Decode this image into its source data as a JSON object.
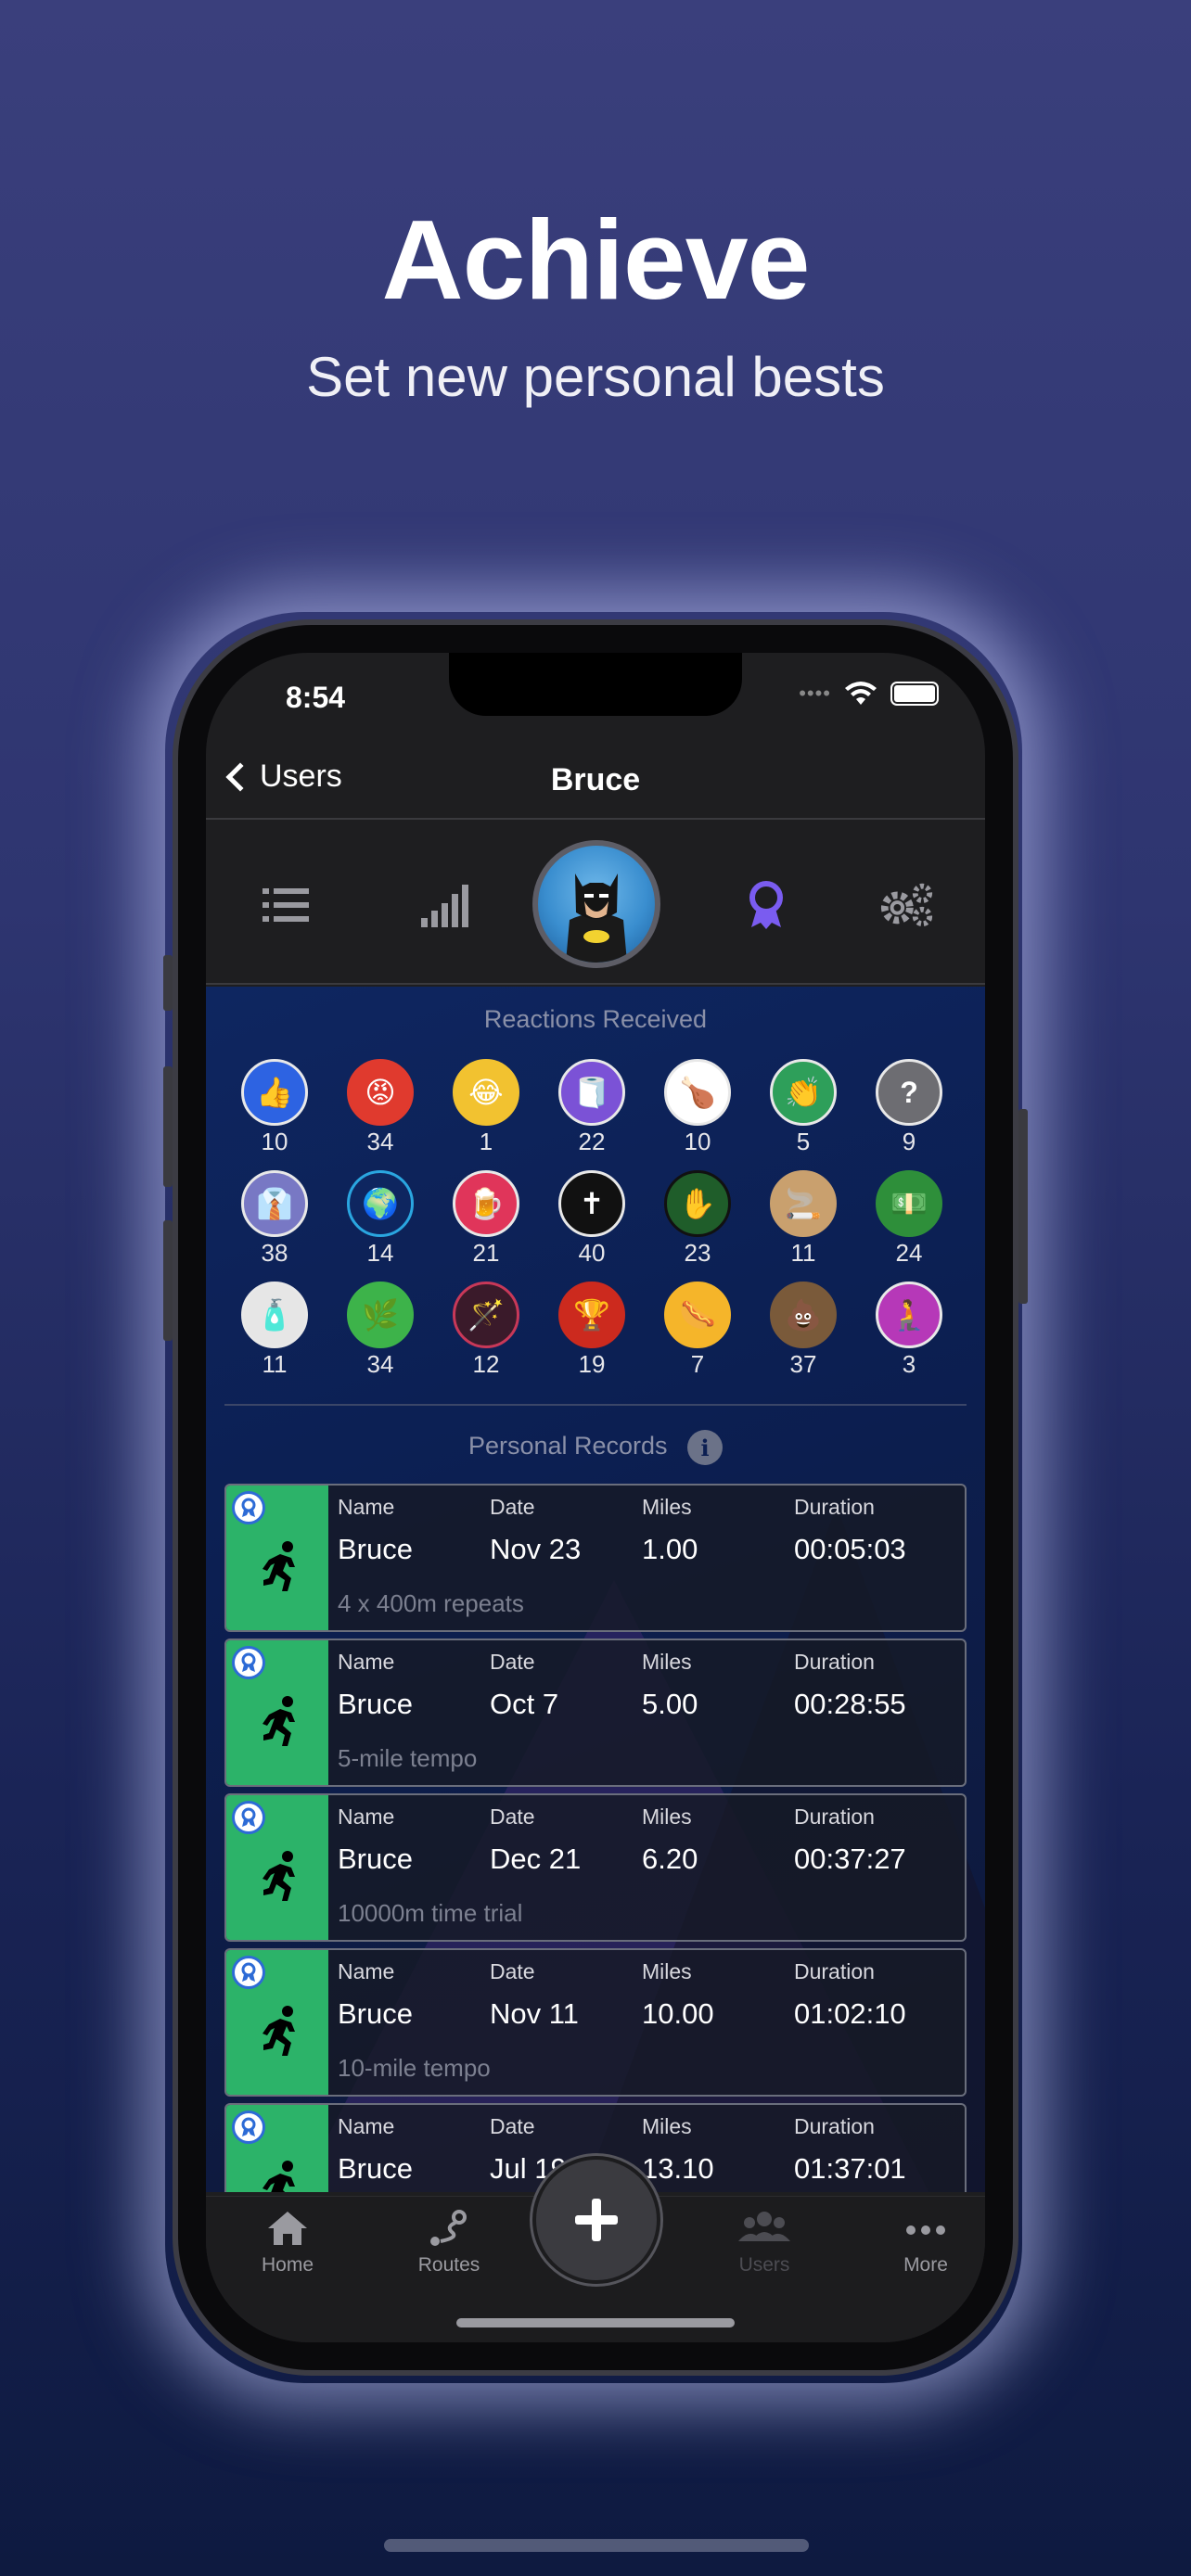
{
  "hero": {
    "title": "Achieve",
    "subtitle": "Set new personal bests"
  },
  "status_bar": {
    "time": "8:54"
  },
  "nav": {
    "back_label": "Users",
    "title": "Bruce"
  },
  "profile_tabs": [
    "list-icon",
    "signal-bars-icon",
    "avatar",
    "award-ribbon-icon",
    "gears-icon"
  ],
  "reactions": {
    "title": "Reactions Received",
    "items": [
      {
        "icon": "thumbs-up-icon",
        "count": "10",
        "color": "#2d63e2"
      },
      {
        "icon": "angry-face-icon",
        "count": "34",
        "color": "#e03a2e"
      },
      {
        "icon": "laughing-face-icon",
        "count": "1",
        "color": "#f2c230"
      },
      {
        "icon": "toilet-paper-icon",
        "count": "22",
        "color": "#7b52d6"
      },
      {
        "icon": "drumstick-icon",
        "count": "10",
        "color": "#ffffff"
      },
      {
        "icon": "clap-hands-icon",
        "count": "5",
        "color": "#2e9f5a"
      },
      {
        "icon": "question-icon",
        "count": "9",
        "color": "#6d6d72"
      },
      {
        "icon": "person-tie-icon",
        "count": "38",
        "color": "#7878c4"
      },
      {
        "icon": "globe-icon",
        "count": "14",
        "color": "#2aa6e0"
      },
      {
        "icon": "beer-mug-icon",
        "count": "21",
        "color": "#e0355a"
      },
      {
        "icon": "bible-icon",
        "count": "40",
        "color": "#111111"
      },
      {
        "icon": "germ-hand-icon",
        "count": "23",
        "color": "#1f5d2a"
      },
      {
        "icon": "cigarette-icon",
        "count": "11",
        "color": "#c9a06e"
      },
      {
        "icon": "money-icon",
        "count": "24",
        "color": "#2e8f3a"
      },
      {
        "icon": "spray-can-icon",
        "count": "11",
        "color": "#e6e6e6"
      },
      {
        "icon": "cannabis-leaf-icon",
        "count": "34",
        "color": "#3db34a"
      },
      {
        "icon": "magic-wand-icon",
        "count": "12",
        "color": "#c83858"
      },
      {
        "icon": "trophy-icon",
        "count": "19",
        "color": "#cc2a1e"
      },
      {
        "icon": "hot-dog-icon",
        "count": "7",
        "color": "#f5b52a"
      },
      {
        "icon": "poop-icon",
        "count": "37",
        "color": "#7a5a3a"
      },
      {
        "icon": "kneeling-person-icon",
        "count": "3",
        "color": "#b638b8"
      }
    ]
  },
  "records": {
    "title": "Personal Records",
    "labels": {
      "name": "Name",
      "date": "Date",
      "miles": "Miles",
      "duration": "Duration"
    },
    "items": [
      {
        "name": "Bruce",
        "date": "Nov 23",
        "miles": "1.00",
        "duration": "00:05:03",
        "desc": "4 x 400m repeats"
      },
      {
        "name": "Bruce",
        "date": "Oct 7",
        "miles": "5.00",
        "duration": "00:28:55",
        "desc": "5-mile tempo"
      },
      {
        "name": "Bruce",
        "date": "Dec 21",
        "miles": "6.20",
        "duration": "00:37:27",
        "desc": "10000m time trial"
      },
      {
        "name": "Bruce",
        "date": "Nov 11",
        "miles": "10.00",
        "duration": "01:02:10",
        "desc": "10-mile tempo"
      },
      {
        "name": "Bruce",
        "date": "Jul 19",
        "miles": "13.10",
        "duration": "01:37:01",
        "desc": ""
      }
    ]
  },
  "tabbar": {
    "home": "Home",
    "routes": "Routes",
    "users": "Users",
    "more": "More"
  }
}
